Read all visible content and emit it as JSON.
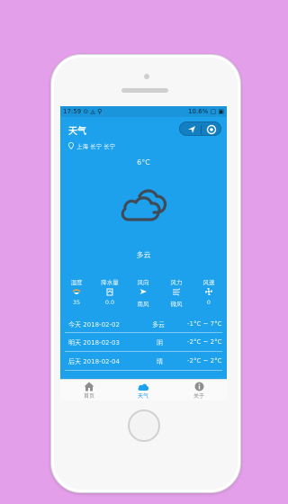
{
  "status": {
    "time": "17:59",
    "left_icons": "⊙ ◬ ⚲",
    "battery": "10.6%",
    "right_icons": "▢ ▣"
  },
  "header": {
    "title": "天气"
  },
  "location": {
    "text": "上海 长宁 长宁"
  },
  "weather": {
    "temperature": "6°C",
    "condition": "多云",
    "icon": "cloud-icon"
  },
  "metrics": [
    {
      "label": "湿度",
      "icon": "humidity-icon",
      "value": "35"
    },
    {
      "label": "降水量",
      "icon": "rain-gauge-icon",
      "value": "0.0"
    },
    {
      "label": "风向",
      "icon": "wind-direction-icon",
      "value": "南风"
    },
    {
      "label": "风力",
      "icon": "wind-power-icon",
      "value": "微风"
    },
    {
      "label": "风速",
      "icon": "wind-speed-icon",
      "value": "0"
    }
  ],
  "forecast": [
    {
      "day": "今天 2018-02-02",
      "cond": "多云",
      "range": "-1°C ~ 7°C"
    },
    {
      "day": "明天 2018-02-03",
      "cond": "阴",
      "range": "-2°C ~ 2°C"
    },
    {
      "day": "后天 2018-02-04",
      "cond": "晴",
      "range": "-2°C ~ 2°C"
    }
  ],
  "tabs": [
    {
      "label": "首页",
      "icon": "home-icon"
    },
    {
      "label": "天气",
      "icon": "cloud-icon",
      "active": true
    },
    {
      "label": "关于",
      "icon": "info-icon"
    }
  ],
  "colors": {
    "screen_bg": "#1da1ec",
    "accent": "#1da1ec",
    "page_bg": "#e39fe9",
    "cloud": "#3f4b57"
  }
}
